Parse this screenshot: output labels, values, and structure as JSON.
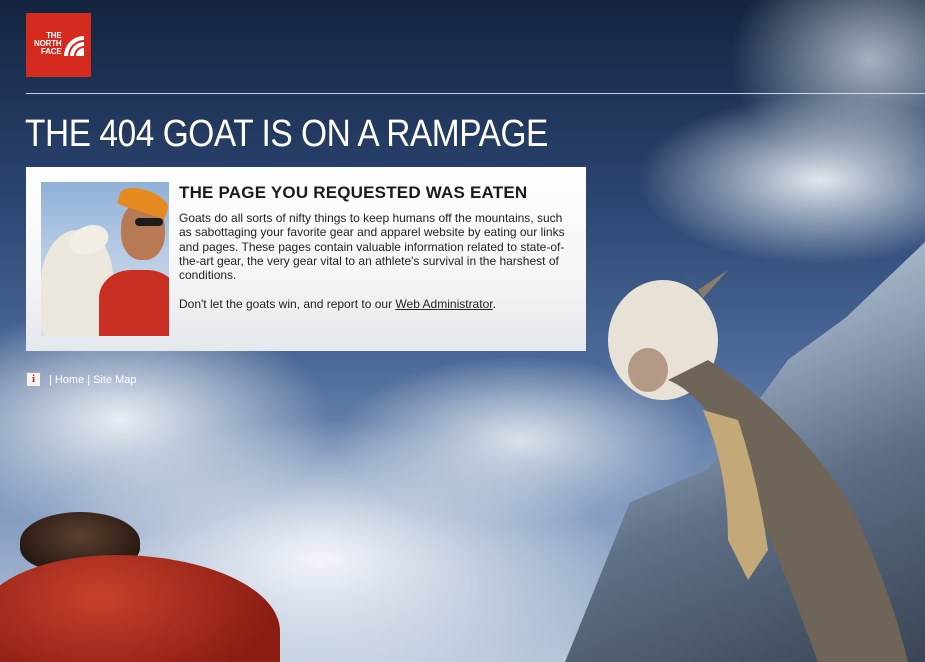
{
  "brand": {
    "logo_text": "THE NORTH FACE",
    "logo_color": "#d52b1e"
  },
  "headline": "THE 404 GOAT IS ON A RAMPAGE",
  "panel": {
    "title": "THE PAGE YOU REQUESTED WAS EATEN",
    "body": "Goats do all sorts of nifty things to keep humans off the mountains, such as sabottaging your favorite gear and apparel website by eating our links and pages. These pages contain valuable information related to state-of-the-art gear, the very gear vital to an athlete's survival in the harshest of conditions.",
    "footer_prefix": "Don't let the goats win, and report to our ",
    "footer_link": "Web Administrator",
    "footer_suffix": "."
  },
  "footer_nav": {
    "icon": "info-icon",
    "separator": "|",
    "items": [
      "Home",
      "Site Map"
    ]
  }
}
